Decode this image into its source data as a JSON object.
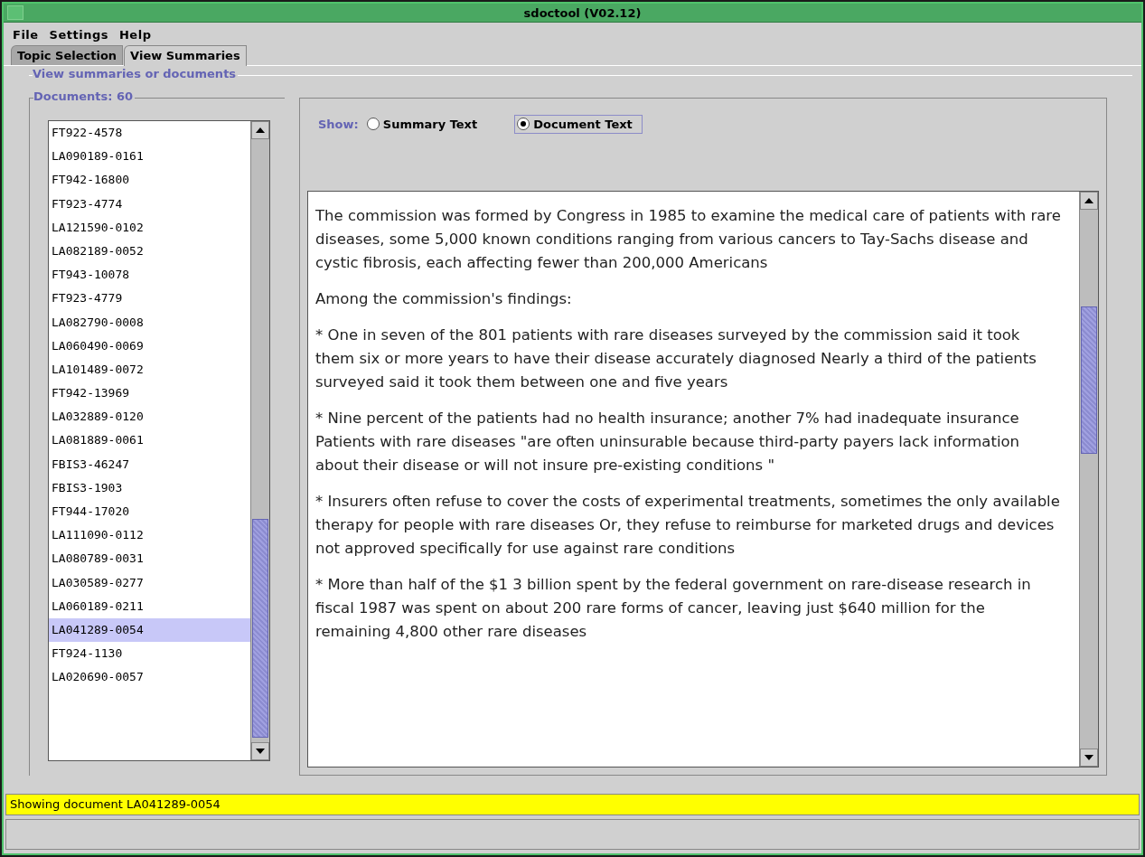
{
  "window": {
    "title": "sdoctool (V02.12)"
  },
  "menu": [
    "File",
    "Settings",
    "Help"
  ],
  "tabs": [
    {
      "label": "Topic Selection",
      "selected": false
    },
    {
      "label": "View Summaries",
      "selected": true
    }
  ],
  "group_title": "View summaries or documents",
  "documents": {
    "title": "Documents: 60",
    "items": [
      {
        "label": "FT922-4578",
        "selected": false
      },
      {
        "label": "LA090189-0161",
        "selected": false
      },
      {
        "label": "FT942-16800",
        "selected": false
      },
      {
        "label": "FT923-4774",
        "selected": false
      },
      {
        "label": "LA121590-0102",
        "selected": false
      },
      {
        "label": "LA082189-0052",
        "selected": false
      },
      {
        "label": "FT943-10078",
        "selected": false
      },
      {
        "label": "FT923-4779",
        "selected": false
      },
      {
        "label": "LA082790-0008",
        "selected": false
      },
      {
        "label": "LA060490-0069",
        "selected": false
      },
      {
        "label": "LA101489-0072",
        "selected": false
      },
      {
        "label": "FT942-13969",
        "selected": false
      },
      {
        "label": "LA032889-0120",
        "selected": false
      },
      {
        "label": "LA081889-0061",
        "selected": false
      },
      {
        "label": "FBIS3-46247",
        "selected": false
      },
      {
        "label": "FBIS3-1903",
        "selected": false
      },
      {
        "label": "FT944-17020",
        "selected": false
      },
      {
        "label": "LA111090-0112",
        "selected": false
      },
      {
        "label": "LA080789-0031",
        "selected": false
      },
      {
        "label": "LA030589-0277",
        "selected": false
      },
      {
        "label": "LA060189-0211",
        "selected": false
      },
      {
        "label": "LA041289-0054",
        "selected": true
      },
      {
        "label": "FT924-1130",
        "selected": false
      },
      {
        "label": "LA020690-0057",
        "selected": false
      }
    ]
  },
  "show": {
    "label": "Show:",
    "options": [
      {
        "label": "Summary Text",
        "selected": false
      },
      {
        "label": "Document Text",
        "selected": true
      }
    ]
  },
  "document_text": [
    "The commission was formed by Congress in 1985 to examine the medical care of patients with rare diseases, some 5,000 known conditions ranging from various cancers to Tay-Sachs disease and cystic fibrosis, each affecting fewer than 200,000 Americans",
    "Among the commission's findings:",
    "* One in seven of the 801 patients with rare diseases surveyed by the commission said it took them six or more years to have their disease accurately diagnosed Nearly a third of the patients surveyed said it took them between one and five years",
    "* Nine percent of the patients had no health insurance; another 7% had inadequate insurance Patients with rare diseases \"are often uninsurable because third-party payers lack information about their disease or will not insure pre-existing conditions \"",
    "* Insurers often refuse to cover the costs of experimental treatments, sometimes the only available therapy for people with rare diseases Or, they refuse to reimburse for marketed drugs and devices not approved specifically for use against rare conditions",
    "* More than half of the $1 3 billion spent by the federal government on rare-disease research in fiscal 1987 was spent on about 200 rare forms of cancer, leaving just $640 million for the remaining 4,800 other rare diseases"
  ],
  "status_bar": "Showing document LA041289-0054"
}
